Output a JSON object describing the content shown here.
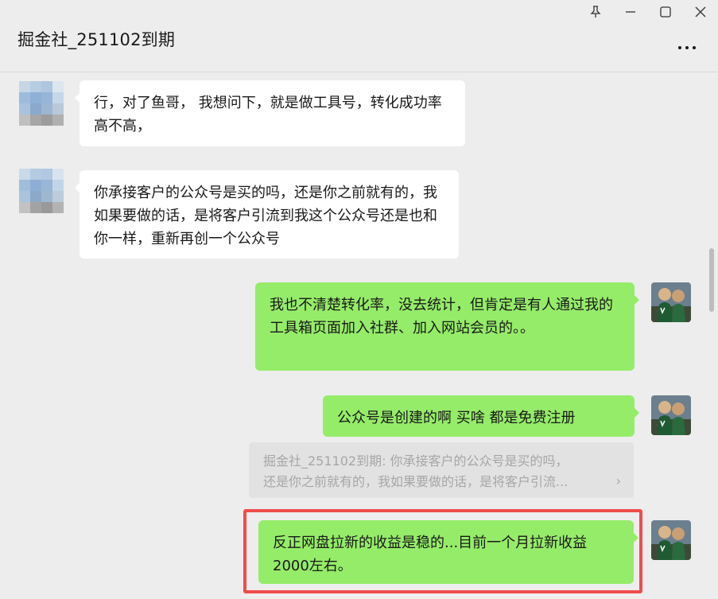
{
  "window": {
    "title": "掘金社_251102到期",
    "controls": [
      "pin-icon",
      "minimize-icon",
      "maximize-icon",
      "close-icon"
    ],
    "more_icon": "more-dots-icon"
  },
  "colors": {
    "background": "#ededed",
    "incoming_bubble": "#ffffff",
    "outgoing_bubble": "#95ec69",
    "highlight_border": "#f04b4b",
    "quote_background": "#e2e2e2"
  },
  "messages": [
    {
      "side": "left",
      "text": "行，对了鱼哥， 我想问下，就是做工具号，转化成功率高不高，"
    },
    {
      "side": "left",
      "text": "你承接客户的公众号是买的吗，还是你之前就有的，我如果要做的话，是将客户引流到我这个公众号还是也和你一样，重新再创一个公众号"
    },
    {
      "side": "right",
      "text": "我也不清楚转化率，没去统计，但肯定是有人通过我的工具箱页面加入社群、加入网站会员的。。"
    },
    {
      "side": "right",
      "text": "公众号是创建的啊  买啥 都是免费注册"
    },
    {
      "side": "right",
      "text": "反正网盘拉新的收益是稳的...目前一个月拉新收益2000左右。",
      "highlighted": true
    }
  ],
  "quote": {
    "line1": "掘金社_251102到期: 你承接客户的公众号是买的吗，",
    "line2": "还是你之前就有的，我如果要做的话，是将客户引流...",
    "chevron": "›"
  }
}
